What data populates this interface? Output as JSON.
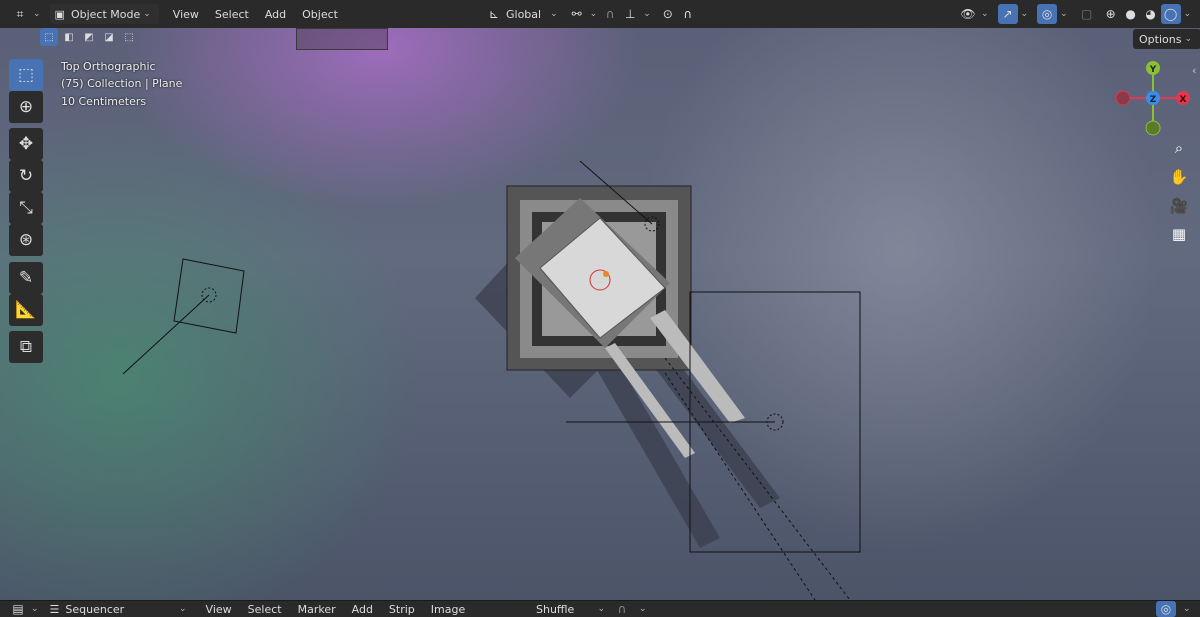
{
  "header": {
    "editor_type_icon": "viewport-icon",
    "mode": "Object Mode",
    "menus": [
      "View",
      "Select",
      "Add",
      "Object"
    ],
    "transform_orientation": "Global",
    "options_label": "Options"
  },
  "overlay_text": {
    "view_name": "Top Orthographic",
    "collection": "(75) Collection | Plane",
    "scale": "10 Centimeters"
  },
  "gizmo": {
    "axes": [
      "Y",
      "Z",
      "X"
    ],
    "colors": {
      "x": "#e0384f",
      "y": "#8bc034",
      "z": "#3d8ce8"
    }
  },
  "tools": [
    "select-box",
    "cursor",
    "move",
    "rotate",
    "scale",
    "transform",
    "annotate",
    "measure",
    "add-cube"
  ],
  "shading": {
    "active": "rendered"
  },
  "footer": {
    "editor": "Sequencer",
    "menus": [
      "View",
      "Select",
      "Marker",
      "Add",
      "Strip",
      "Image"
    ],
    "mode": "Shuffle"
  },
  "colors": {
    "accent": "#4772b3",
    "header_bg": "#2a2a2a"
  }
}
